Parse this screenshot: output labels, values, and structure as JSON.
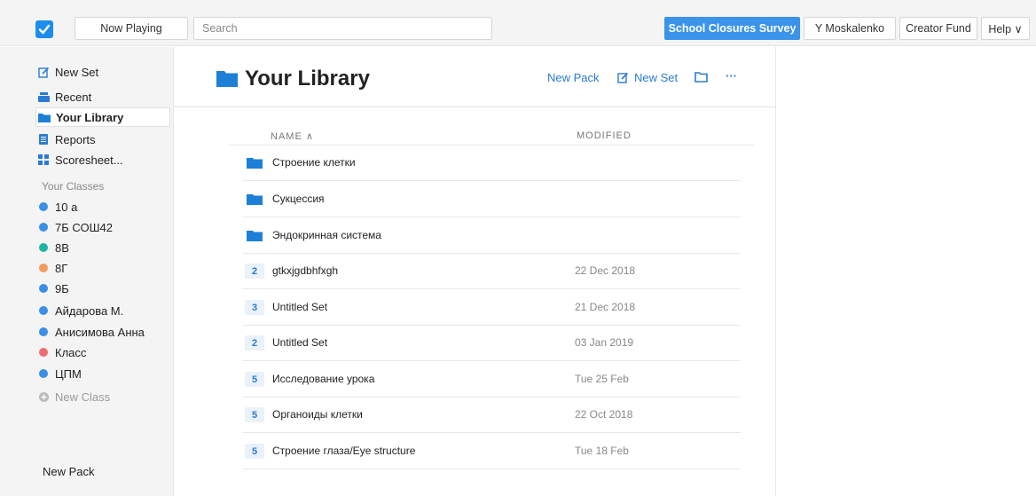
{
  "topbar": {
    "now_playing": "Now Playing",
    "search_placeholder": "Search",
    "survey": "School Closures Survey",
    "user": "Y Moskalenko",
    "creator_fund": "Creator Fund",
    "help": "Help ∨"
  },
  "sidebar": {
    "new_set": "New Set",
    "recent": "Recent",
    "your_library": "Your Library",
    "reports": "Reports",
    "scoresheet": "Scoresheet...",
    "classes_header": "Your Classes",
    "classes": [
      {
        "label": "10 а",
        "color": "#3b8fe6"
      },
      {
        "label": "7Б СОШ42",
        "color": "#3b8fe6"
      },
      {
        "label": "8В",
        "color": "#1fb3a5"
      },
      {
        "label": "8Г",
        "color": "#f39b5a"
      },
      {
        "label": "9Б",
        "color": "#3b8fe6"
      },
      {
        "label": "Айдарова М.",
        "color": "#3b8fe6"
      },
      {
        "label": "Анисимова Анна",
        "color": "#3b8fe6"
      },
      {
        "label": "Класс",
        "color": "#ee6e73"
      },
      {
        "label": "ЦПМ",
        "color": "#3b8fe6"
      }
    ],
    "new_class": "New Class",
    "new_pack": "New Pack"
  },
  "main": {
    "title": "Your Library",
    "new_pack": "New Pack",
    "new_set": "New Set",
    "more": "···",
    "col_name": "NAME ∧",
    "col_modified": "MODIFIED",
    "rows": [
      {
        "type": "folder",
        "name": "Строение клетки",
        "date": ""
      },
      {
        "type": "folder",
        "name": "Сукцессия",
        "date": ""
      },
      {
        "type": "folder",
        "name": "Эндокринная система",
        "date": ""
      },
      {
        "type": "set",
        "count": "2",
        "name": "gtkxjgdbhfxgh",
        "date": "22 Dec 2018"
      },
      {
        "type": "set",
        "count": "3",
        "name": "Untitled Set",
        "date": "21 Dec 2018"
      },
      {
        "type": "set",
        "count": "2",
        "name": "Untitled Set",
        "date": "03 Jan 2019"
      },
      {
        "type": "set",
        "count": "5",
        "name": "Исследование урока",
        "date": "Tue 25 Feb"
      },
      {
        "type": "set",
        "count": "5",
        "name": "Органоиды клетки",
        "date": "22 Oct 2018"
      },
      {
        "type": "set",
        "count": "5",
        "name": "Строение глаза/Eye structure",
        "date": "Tue 18 Feb"
      }
    ]
  },
  "colors": {
    "accent": "#3b94ea",
    "link": "#2b7bd4",
    "folder": "#1d7fd6"
  }
}
